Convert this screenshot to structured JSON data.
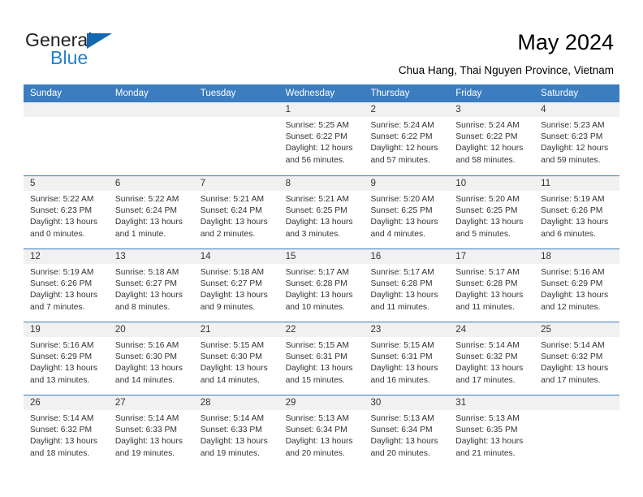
{
  "brand": {
    "name_part1": "General",
    "name_part2": "Blue",
    "triangle_color": "#1468b3",
    "blue_color": "#2383c8"
  },
  "header": {
    "title": "May 2024",
    "subtitle": "Chua Hang, Thai Nguyen Province, Vietnam"
  },
  "theme": {
    "header_blue": "#3b7dbf",
    "day_band_gray": "#f1f1f1",
    "text_color": "#333333"
  },
  "weekdays": [
    "Sunday",
    "Monday",
    "Tuesday",
    "Wednesday",
    "Thursday",
    "Friday",
    "Saturday"
  ],
  "weeks": [
    [
      {
        "day": "",
        "sunrise": "",
        "sunset": "",
        "daylight": ""
      },
      {
        "day": "",
        "sunrise": "",
        "sunset": "",
        "daylight": ""
      },
      {
        "day": "",
        "sunrise": "",
        "sunset": "",
        "daylight": ""
      },
      {
        "day": "1",
        "sunrise": "Sunrise: 5:25 AM",
        "sunset": "Sunset: 6:22 PM",
        "daylight": "Daylight: 12 hours and 56 minutes."
      },
      {
        "day": "2",
        "sunrise": "Sunrise: 5:24 AM",
        "sunset": "Sunset: 6:22 PM",
        "daylight": "Daylight: 12 hours and 57 minutes."
      },
      {
        "day": "3",
        "sunrise": "Sunrise: 5:24 AM",
        "sunset": "Sunset: 6:22 PM",
        "daylight": "Daylight: 12 hours and 58 minutes."
      },
      {
        "day": "4",
        "sunrise": "Sunrise: 5:23 AM",
        "sunset": "Sunset: 6:23 PM",
        "daylight": "Daylight: 12 hours and 59 minutes."
      }
    ],
    [
      {
        "day": "5",
        "sunrise": "Sunrise: 5:22 AM",
        "sunset": "Sunset: 6:23 PM",
        "daylight": "Daylight: 13 hours and 0 minutes."
      },
      {
        "day": "6",
        "sunrise": "Sunrise: 5:22 AM",
        "sunset": "Sunset: 6:24 PM",
        "daylight": "Daylight: 13 hours and 1 minute."
      },
      {
        "day": "7",
        "sunrise": "Sunrise: 5:21 AM",
        "sunset": "Sunset: 6:24 PM",
        "daylight": "Daylight: 13 hours and 2 minutes."
      },
      {
        "day": "8",
        "sunrise": "Sunrise: 5:21 AM",
        "sunset": "Sunset: 6:25 PM",
        "daylight": "Daylight: 13 hours and 3 minutes."
      },
      {
        "day": "9",
        "sunrise": "Sunrise: 5:20 AM",
        "sunset": "Sunset: 6:25 PM",
        "daylight": "Daylight: 13 hours and 4 minutes."
      },
      {
        "day": "10",
        "sunrise": "Sunrise: 5:20 AM",
        "sunset": "Sunset: 6:25 PM",
        "daylight": "Daylight: 13 hours and 5 minutes."
      },
      {
        "day": "11",
        "sunrise": "Sunrise: 5:19 AM",
        "sunset": "Sunset: 6:26 PM",
        "daylight": "Daylight: 13 hours and 6 minutes."
      }
    ],
    [
      {
        "day": "12",
        "sunrise": "Sunrise: 5:19 AM",
        "sunset": "Sunset: 6:26 PM",
        "daylight": "Daylight: 13 hours and 7 minutes."
      },
      {
        "day": "13",
        "sunrise": "Sunrise: 5:18 AM",
        "sunset": "Sunset: 6:27 PM",
        "daylight": "Daylight: 13 hours and 8 minutes."
      },
      {
        "day": "14",
        "sunrise": "Sunrise: 5:18 AM",
        "sunset": "Sunset: 6:27 PM",
        "daylight": "Daylight: 13 hours and 9 minutes."
      },
      {
        "day": "15",
        "sunrise": "Sunrise: 5:17 AM",
        "sunset": "Sunset: 6:28 PM",
        "daylight": "Daylight: 13 hours and 10 minutes."
      },
      {
        "day": "16",
        "sunrise": "Sunrise: 5:17 AM",
        "sunset": "Sunset: 6:28 PM",
        "daylight": "Daylight: 13 hours and 11 minutes."
      },
      {
        "day": "17",
        "sunrise": "Sunrise: 5:17 AM",
        "sunset": "Sunset: 6:28 PM",
        "daylight": "Daylight: 13 hours and 11 minutes."
      },
      {
        "day": "18",
        "sunrise": "Sunrise: 5:16 AM",
        "sunset": "Sunset: 6:29 PM",
        "daylight": "Daylight: 13 hours and 12 minutes."
      }
    ],
    [
      {
        "day": "19",
        "sunrise": "Sunrise: 5:16 AM",
        "sunset": "Sunset: 6:29 PM",
        "daylight": "Daylight: 13 hours and 13 minutes."
      },
      {
        "day": "20",
        "sunrise": "Sunrise: 5:16 AM",
        "sunset": "Sunset: 6:30 PM",
        "daylight": "Daylight: 13 hours and 14 minutes."
      },
      {
        "day": "21",
        "sunrise": "Sunrise: 5:15 AM",
        "sunset": "Sunset: 6:30 PM",
        "daylight": "Daylight: 13 hours and 14 minutes."
      },
      {
        "day": "22",
        "sunrise": "Sunrise: 5:15 AM",
        "sunset": "Sunset: 6:31 PM",
        "daylight": "Daylight: 13 hours and 15 minutes."
      },
      {
        "day": "23",
        "sunrise": "Sunrise: 5:15 AM",
        "sunset": "Sunset: 6:31 PM",
        "daylight": "Daylight: 13 hours and 16 minutes."
      },
      {
        "day": "24",
        "sunrise": "Sunrise: 5:14 AM",
        "sunset": "Sunset: 6:32 PM",
        "daylight": "Daylight: 13 hours and 17 minutes."
      },
      {
        "day": "25",
        "sunrise": "Sunrise: 5:14 AM",
        "sunset": "Sunset: 6:32 PM",
        "daylight": "Daylight: 13 hours and 17 minutes."
      }
    ],
    [
      {
        "day": "26",
        "sunrise": "Sunrise: 5:14 AM",
        "sunset": "Sunset: 6:32 PM",
        "daylight": "Daylight: 13 hours and 18 minutes."
      },
      {
        "day": "27",
        "sunrise": "Sunrise: 5:14 AM",
        "sunset": "Sunset: 6:33 PM",
        "daylight": "Daylight: 13 hours and 19 minutes."
      },
      {
        "day": "28",
        "sunrise": "Sunrise: 5:14 AM",
        "sunset": "Sunset: 6:33 PM",
        "daylight": "Daylight: 13 hours and 19 minutes."
      },
      {
        "day": "29",
        "sunrise": "Sunrise: 5:13 AM",
        "sunset": "Sunset: 6:34 PM",
        "daylight": "Daylight: 13 hours and 20 minutes."
      },
      {
        "day": "30",
        "sunrise": "Sunrise: 5:13 AM",
        "sunset": "Sunset: 6:34 PM",
        "daylight": "Daylight: 13 hours and 20 minutes."
      },
      {
        "day": "31",
        "sunrise": "Sunrise: 5:13 AM",
        "sunset": "Sunset: 6:35 PM",
        "daylight": "Daylight: 13 hours and 21 minutes."
      },
      {
        "day": "",
        "sunrise": "",
        "sunset": "",
        "daylight": ""
      }
    ]
  ]
}
